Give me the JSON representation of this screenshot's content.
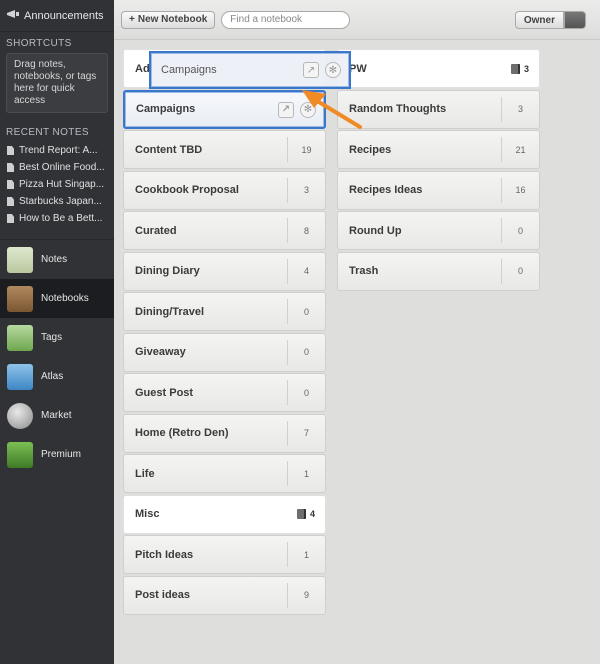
{
  "sidebar": {
    "announcements": "Announcements",
    "shortcuts_title": "SHORTCUTS",
    "shortcuts_hint": "Drag notes, notebooks, or tags here for quick access",
    "recent_title": "RECENT NOTES",
    "recent_notes": [
      "Trend Report: A...",
      "Best Online Food...",
      "Pizza Hut Singap...",
      "Starbucks Japan...",
      "How to Be a Bett..."
    ],
    "nav": [
      {
        "label": "Notes",
        "icon": "notes-icon"
      },
      {
        "label": "Notebooks",
        "icon": "notebooks-icon"
      },
      {
        "label": "Tags",
        "icon": "tags-icon"
      },
      {
        "label": "Atlas",
        "icon": "atlas-icon"
      },
      {
        "label": "Market",
        "icon": "market-icon"
      },
      {
        "label": "Premium",
        "icon": "premium-icon"
      }
    ]
  },
  "toolbar": {
    "new_notebook": "New Notebook",
    "search_placeholder": "Find a notebook",
    "owner_label": "Owner"
  },
  "notebooks_left": [
    {
      "name": "Ad",
      "count": ""
    },
    {
      "name": "Campaigns",
      "count": ""
    },
    {
      "name": "Content TBD",
      "count": "19"
    },
    {
      "name": "Cookbook Proposal",
      "count": "3"
    },
    {
      "name": "Curated",
      "count": "8"
    },
    {
      "name": "Dining Diary",
      "count": "4"
    },
    {
      "name": "Dining/Travel",
      "count": "0"
    },
    {
      "name": "Giveaway",
      "count": "0"
    },
    {
      "name": "Guest Post",
      "count": "0"
    },
    {
      "name": "Home (Retro Den)",
      "count": "7"
    },
    {
      "name": "Life",
      "count": "1"
    },
    {
      "name": "Misc",
      "count": "4"
    },
    {
      "name": "Pitch Ideas",
      "count": "1"
    },
    {
      "name": "Post ideas",
      "count": "9"
    }
  ],
  "notebooks_right": [
    {
      "name": "PW",
      "count": "3"
    },
    {
      "name": "Random Thoughts",
      "count": "3"
    },
    {
      "name": "Recipes",
      "count": "21"
    },
    {
      "name": "Recipes Ideas",
      "count": "16"
    },
    {
      "name": "Round Up",
      "count": "0"
    },
    {
      "name": "Trash",
      "count": "0"
    }
  ],
  "drag_ghost": {
    "name": "Campaigns"
  },
  "colors": {
    "selection": "#3a76c9",
    "arrow": "#f08a24"
  }
}
